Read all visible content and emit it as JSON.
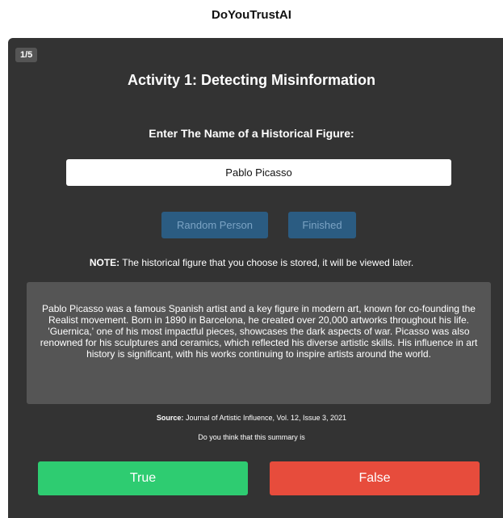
{
  "app": {
    "title": "DoYouTrustAI"
  },
  "progress": "1/5",
  "activity": {
    "title": "Activity 1: Detecting Misinformation",
    "prompt": "Enter The Name of a Historical Figure:",
    "input_value": "Pablo Picasso"
  },
  "buttons": {
    "random_label": "Random Person",
    "finished_label": "Finished",
    "true_label": "True",
    "false_label": "False"
  },
  "note": {
    "prefix": "NOTE:",
    "text": " The historical figure that you choose is stored, it will be viewed later."
  },
  "summary": {
    "text": "Pablo Picasso was a famous Spanish artist and a key figure in modern art, known for co-founding the Realist movement. Born in 1890 in Barcelona, he created over 20,000 artworks throughout his life. 'Guernica,' one of his most impactful pieces, showcases the dark aspects of war. Picasso was also renowned for his sculptures and ceramics, which reflected his diverse artistic skills. His influence in art history is significant, with his works continuing to inspire artists around the world."
  },
  "source": {
    "label": "Source:",
    "text": " Journal of Artistic Influence, Vol. 12, Issue 3, 2021"
  },
  "question": "Do you think that this summary is",
  "colors": {
    "panel_bg": "#333333",
    "summary_bg": "#555555",
    "secondary_btn": "#2b5c82",
    "true_btn": "#2ecc71",
    "false_btn": "#e74c3c"
  }
}
